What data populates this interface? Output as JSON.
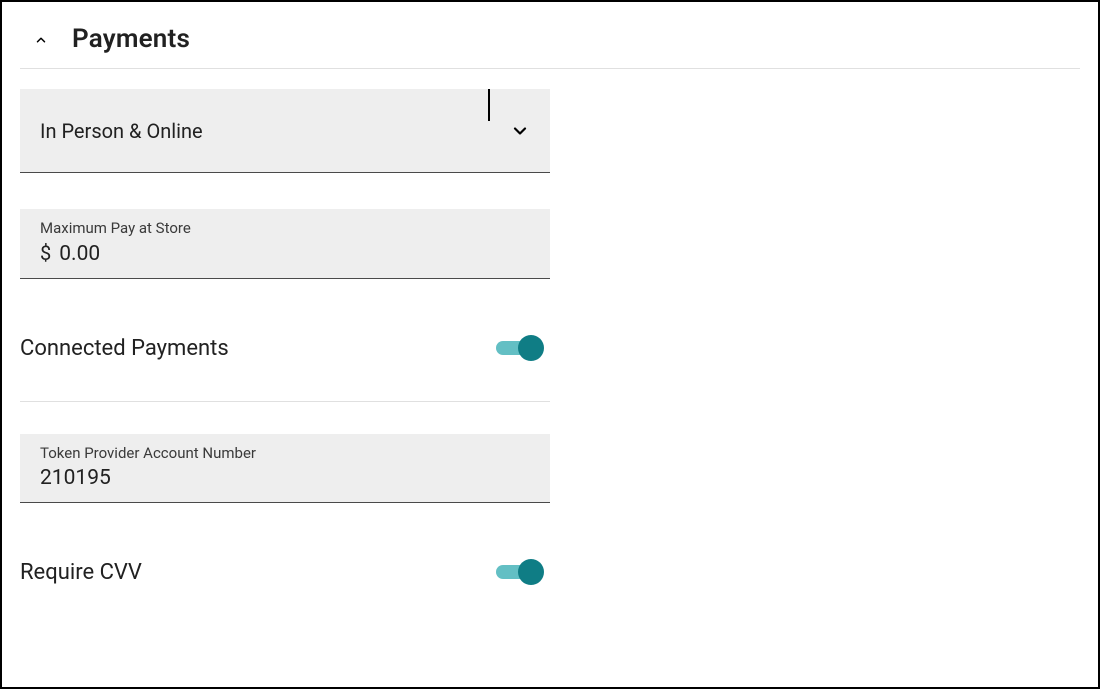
{
  "section": {
    "title": "Payments"
  },
  "payment_mode_select": {
    "value": "In Person & Online"
  },
  "max_pay_at_store": {
    "label": "Maximum Pay at Store",
    "prefix": "$",
    "value": "0.00"
  },
  "connected_payments": {
    "label": "Connected Payments",
    "enabled": true
  },
  "token_provider": {
    "label": "Token Provider Account Number",
    "value": "210195"
  },
  "require_cvv": {
    "label": "Require CVV",
    "enabled": true
  }
}
